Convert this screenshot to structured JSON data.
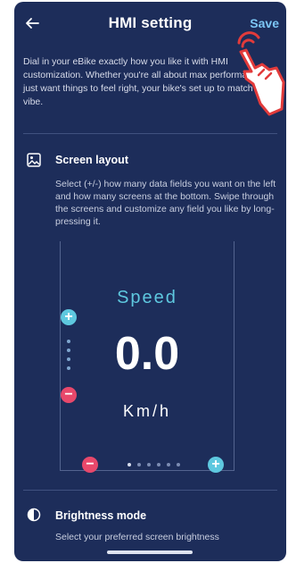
{
  "header": {
    "title": "HMI setting",
    "save_label": "Save",
    "back_icon": "back-arrow-icon"
  },
  "intro_text": "Dial in your eBike exactly how you like it with HMI customization. Whether you're all about max performance or just want things to feel right, your bike's set up to match your vibe.",
  "screen_layout": {
    "icon": "image-icon",
    "title": "Screen layout",
    "description": "Select (+/-) how many data fields you want on the left and how many screens at the bottom. Swipe through the screens and customize any field you like by long-pressing it."
  },
  "preview": {
    "label": "Speed",
    "value": "0.0",
    "unit": "Km/h",
    "vertical_plus": "+",
    "vertical_minus": "−",
    "horizontal_minus": "−",
    "horizontal_plus": "+"
  },
  "brightness": {
    "icon": "half-circle-icon",
    "title": "Brightness mode",
    "description": "Select your preferred screen brightness"
  },
  "colors": {
    "background": "#1d2d5a",
    "accent": "#5ec8df",
    "danger": "#e8486b",
    "save": "#7cc6f5"
  }
}
